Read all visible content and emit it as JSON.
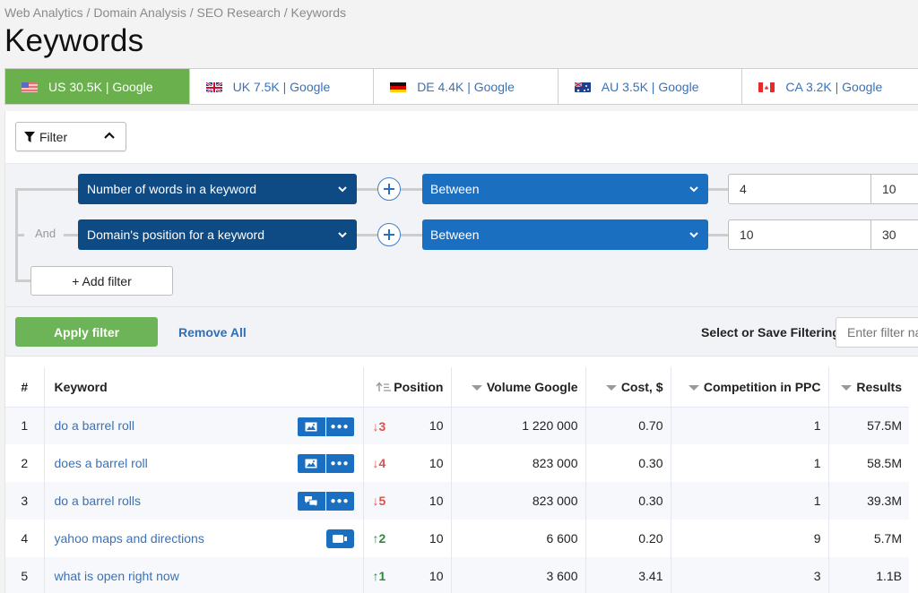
{
  "breadcrumb": "Web Analytics / Domain Analysis / SEO Research / Keywords",
  "page_title": "Keywords",
  "colors": {
    "active_tab": "#6ab04c",
    "field_select": "#0e4a84",
    "operator_select": "#1b6fc1",
    "link": "#3a72b8",
    "down": "#d9534f",
    "up": "#2e8b3d"
  },
  "tabs": [
    {
      "label": "US 30.5K | Google",
      "flag": "us-flag-icon",
      "active": true
    },
    {
      "label": "UK 7.5K | Google",
      "flag": "uk-flag-icon",
      "active": false
    },
    {
      "label": "DE 4.4K | Google",
      "flag": "de-flag-icon",
      "active": false
    },
    {
      "label": "AU 3.5K | Google",
      "flag": "au-flag-icon",
      "active": false
    },
    {
      "label": "CA 3.2K | Google",
      "flag": "ca-flag-icon",
      "active": false
    }
  ],
  "filter": {
    "toggle_label": "Filter",
    "connector_label": "And",
    "rows": [
      {
        "field": "Number of words in a keyword",
        "operator": "Between",
        "from": "4",
        "to": "10"
      },
      {
        "field": "Domain's position for a keyword",
        "operator": "Between",
        "from": "10",
        "to": "30"
      }
    ],
    "add_filter_label": "+ Add filter",
    "apply_label": "Apply filter",
    "remove_all_label": "Remove All",
    "save_label": "Select or Save Filtering:",
    "save_placeholder": "Enter filter name"
  },
  "table": {
    "headers": {
      "num": "#",
      "keyword": "Keyword",
      "position": "Position",
      "volume": "Volume Google",
      "cost": "Cost, $",
      "competition": "Competition in PPC",
      "results": "Results"
    },
    "rows": [
      {
        "num": "1",
        "keyword": "do a barrel roll",
        "serp": [
          "image-icon",
          "more-icon"
        ],
        "change": "↓3",
        "dir": "down",
        "position": "10",
        "volume": "1 220 000",
        "cost": "0.70",
        "competition": "1",
        "results": "57.5M"
      },
      {
        "num": "2",
        "keyword": "does a barrel roll",
        "serp": [
          "image-icon",
          "more-icon"
        ],
        "change": "↓4",
        "dir": "down",
        "position": "10",
        "volume": "823 000",
        "cost": "0.30",
        "competition": "1",
        "results": "58.5M"
      },
      {
        "num": "3",
        "keyword": "do a barrel rolls",
        "serp": [
          "reviews-icon",
          "more-icon"
        ],
        "change": "↓5",
        "dir": "down",
        "position": "10",
        "volume": "823 000",
        "cost": "0.30",
        "competition": "1",
        "results": "39.3M"
      },
      {
        "num": "4",
        "keyword": "yahoo maps and directions",
        "serp": [
          "video-icon"
        ],
        "change": "↑2",
        "dir": "up",
        "position": "10",
        "volume": "6 600",
        "cost": "0.20",
        "competition": "9",
        "results": "5.7M"
      },
      {
        "num": "5",
        "keyword": "what is open right now",
        "serp": [],
        "change": "↑1",
        "dir": "up",
        "position": "10",
        "volume": "3 600",
        "cost": "3.41",
        "competition": "3",
        "results": "1.1B"
      }
    ]
  }
}
